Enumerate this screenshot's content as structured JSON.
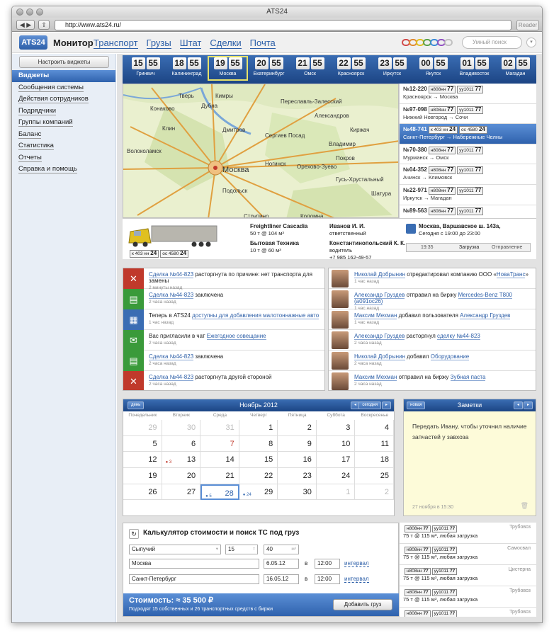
{
  "window": {
    "title": "ATS24",
    "url": "http://www.ats24.ru/",
    "reader": "Reader"
  },
  "header": {
    "logo": "ATS24",
    "title": "Монитор",
    "nav": [
      "Транспорт",
      "Грузы",
      "Штат",
      "Сделки",
      "Почта"
    ],
    "search_placeholder": "Умный поиск"
  },
  "sidebar": {
    "config_button": "Настроить виджеты",
    "items": [
      "Виджеты",
      "Сообщения системы",
      "Действия сотрудников",
      "Подрядчики",
      "Группы компаний",
      "Баланс",
      "Статистика",
      "Отчеты",
      "Справка и помощь"
    ]
  },
  "clocks": [
    {
      "h": "15",
      "m": "55",
      "city": "Гринвич"
    },
    {
      "h": "18",
      "m": "55",
      "city": "Калининград"
    },
    {
      "h": "19",
      "m": "55",
      "city": "Москва"
    },
    {
      "h": "20",
      "m": "55",
      "city": "Екатеринбург"
    },
    {
      "h": "21",
      "m": "55",
      "city": "Омск"
    },
    {
      "h": "22",
      "m": "55",
      "city": "Красноярск"
    },
    {
      "h": "23",
      "m": "55",
      "city": "Иркутск"
    },
    {
      "h": "00",
      "m": "55",
      "city": "Якутск"
    },
    {
      "h": "01",
      "m": "55",
      "city": "Владивосток"
    },
    {
      "h": "02",
      "m": "55",
      "city": "Магадан"
    }
  ],
  "map": {
    "labels": [
      "Тверь",
      "Кимры",
      "Дубна",
      "Сергиев Посад",
      "Дмитров",
      "Клин",
      "Конаково",
      "Переславль-Залесский",
      "Александров",
      "Владимир",
      "Ногинск",
      "Орехово-Зуево",
      "Москва",
      "Подольск",
      "Гусь-Хрустальный",
      "Коломна",
      "Струпино",
      "Волоколамск",
      "Покров",
      "Киржач",
      "Шатура"
    ]
  },
  "trucks": [
    {
      "id": "№12-220",
      "p1": "н808нн",
      "p1r": "77",
      "p2": "уу1011",
      "p2r": "77",
      "route": "Красноярск → Москва"
    },
    {
      "id": "№97-098",
      "p1": "н808нн",
      "p1r": "77",
      "p2": "уу1011",
      "p2r": "77",
      "route": "Нижний Новгород → Сочи"
    },
    {
      "id": "№48-741",
      "p1": "к 403 нн",
      "p1r": "24",
      "p2": "ос 4580",
      "p2r": "24",
      "route": "Санкт-Петербург → Набережные Челны"
    },
    {
      "id": "№70-380",
      "p1": "н808нн",
      "p1r": "77",
      "p2": "уу1011",
      "p2r": "77",
      "route": "Мурманск → Омск"
    },
    {
      "id": "№04-352",
      "p1": "н808нн",
      "p1r": "77",
      "p2": "уу1011",
      "p2r": "77",
      "route": "Ачинск → Климовск"
    },
    {
      "id": "№22-971",
      "p1": "н808нн",
      "p1r": "77",
      "p2": "уу1011",
      "p2r": "77",
      "route": "Иркутск → Магадан"
    },
    {
      "id": "№89-563",
      "p1": "н808нн",
      "p1r": "77",
      "p2": "уу1011",
      "p2r": "77",
      "route": ""
    }
  ],
  "detail": {
    "truck": "Freightliner Cascadia",
    "cap": "50 т @ 104 м³",
    "cargo": "Бытовая Техника",
    "cargo_cap": "10 т @ 60 м³",
    "p1": "к 403 нн",
    "p1r": "24",
    "p2": "ос 4580",
    "p2r": "24",
    "person1": "Иванов И. И.",
    "role1": "ответственный",
    "person2": "Константинопольский К. К.",
    "role2": "водитель",
    "phone": "+7 985 162-49-57",
    "address": "Москва, Варшавское ш. 143а,",
    "time": "Сегодня с 19:00 до 23:00",
    "step_time": "19:35",
    "step1": "Загрузка",
    "step2": "Отправление"
  },
  "events": [
    {
      "link": "Сделка №44-823",
      "text": " расторгнута по причине: нет транспорта для замены",
      "time": "2 минуты назад",
      "color": "#c0392b",
      "icon": "✕"
    },
    {
      "link": "Сделка №44-823",
      "text": " заключена",
      "time": "2 часа назад",
      "color": "#3a9a3a",
      "icon": "▤"
    },
    {
      "pre": "Теперь в ATS24 ",
      "link": "доступны для добавления малотоннажные авто",
      "text": "",
      "time": "1 час назад",
      "color": "#3a6db3",
      "icon": "▦"
    },
    {
      "pre": "Вас пригласили в чат ",
      "link": "Ежегодное совещание",
      "text": "",
      "time": "2 часа назад",
      "color": "#3a9a3a",
      "icon": "✉"
    },
    {
      "link": "Сделка №44-823",
      "text": " заключена",
      "time": "2 часа назад",
      "color": "#3a9a3a",
      "icon": "▤"
    },
    {
      "link": "Сделка №44-823",
      "text": " расторгнута другой стороной",
      "time": "2 часа назад",
      "color": "#c0392b",
      "icon": "✕"
    }
  ],
  "feed": [
    {
      "who": "Николай Добрынин",
      "what": " отредактировал компанию ООО «",
      "obj": "НоваТранс",
      "post": "»",
      "time": "1 час назад"
    },
    {
      "who": "Александр Груздев",
      "what": " отправил на биржу ",
      "obj": "Mercedes-Benz T800 (а091ос26)",
      "post": "",
      "time": "1 час назад"
    },
    {
      "who": "Максим Мехман",
      "what": " добавил пользователя ",
      "obj": "Александр Груздев",
      "post": "",
      "time": "1 час назад"
    },
    {
      "who": "Александр Груздев",
      "what": " расторгнул ",
      "obj": "сделку №44-823",
      "post": "",
      "time": "2 часа назад"
    },
    {
      "who": "Николай Добрынин",
      "what": " добавил ",
      "obj": "Оборудование",
      "post": "",
      "time": "2 часа назад"
    },
    {
      "who": "Максим Мехман",
      "what": " отправил на биржу ",
      "obj": "Зубная паста",
      "post": "",
      "time": "2 часа назад"
    }
  ],
  "calendar": {
    "month": "Ноябрь 2012",
    "day_btn": "день",
    "today_btn": "сегодня",
    "weekdays": [
      "Понедельник",
      "Вторник",
      "Среда",
      "Четверг",
      "Пятница",
      "Суббота",
      "Воскресенье"
    ],
    "days": [
      [
        "29",
        "o"
      ],
      [
        "30",
        "o"
      ],
      [
        "31",
        "o"
      ],
      [
        "1",
        ""
      ],
      [
        "2",
        ""
      ],
      [
        "3",
        ""
      ],
      [
        "4",
        ""
      ],
      [
        "5",
        ""
      ],
      [
        "6",
        ""
      ],
      [
        "7",
        "red"
      ],
      [
        "8",
        ""
      ],
      [
        "9",
        ""
      ],
      [
        "10",
        ""
      ],
      [
        "11",
        ""
      ],
      [
        "12",
        ""
      ],
      [
        "13",
        ""
      ],
      [
        "14",
        ""
      ],
      [
        "15",
        ""
      ],
      [
        "16",
        ""
      ],
      [
        "17",
        ""
      ],
      [
        "18",
        ""
      ],
      [
        "19",
        ""
      ],
      [
        "20",
        ""
      ],
      [
        "21",
        ""
      ],
      [
        "22",
        ""
      ],
      [
        "23",
        ""
      ],
      [
        "24",
        ""
      ],
      [
        "25",
        ""
      ],
      [
        "26",
        ""
      ],
      [
        "27",
        ""
      ],
      [
        "28",
        "today"
      ],
      [
        "29",
        ""
      ],
      [
        "30",
        ""
      ],
      [
        "1",
        "o"
      ],
      [
        "2",
        "o"
      ]
    ],
    "marks": {
      "13": "3",
      "28": "5",
      "29": "24"
    }
  },
  "notes": {
    "title": "Заметки",
    "new_btn": "новая",
    "text": "Передать Ивану, чтобы уточнил наличие запчастей у завхоза",
    "date": "27 ноября в 15:30"
  },
  "calc": {
    "title": "Калькулятор стоимости и поиск ТС под груз",
    "type": "Сыпучий",
    "weight": "15",
    "weight_unit": "т",
    "volume": "40",
    "volume_unit": "м³",
    "from": "Москва",
    "from_date": "6.05.12",
    "from_time": "12:00",
    "to": "Санкт-Петербург",
    "to_date": "16.05.12",
    "to_time": "12:00",
    "interval": "интервал",
    "in": "в",
    "cost": "Стоимость: ≈ 35 500 ₽",
    "cost_sub": "Подходят 15 собственных и 26 транспортных средств с биржи",
    "add_btn": "Добавить груз"
  },
  "results": [
    {
      "p1": "н808нн",
      "p1r": "77",
      "p2": "уу1011",
      "p2r": "77",
      "spec": "75 т @ 115 м³, любая загрузка",
      "type": "Трубовоз"
    },
    {
      "p1": "н808нн",
      "p1r": "77",
      "p2": "уу1011",
      "p2r": "77",
      "spec": "75 т @ 115 м³, любая загрузка",
      "type": "Самосвал"
    },
    {
      "p1": "н808нн",
      "p1r": "77",
      "p2": "уу1011",
      "p2r": "77",
      "spec": "75 т @ 115 м³, любая загрузка",
      "type": "Цистерна"
    },
    {
      "p1": "н808нн",
      "p1r": "77",
      "p2": "уу1011",
      "p2r": "77",
      "spec": "75 т @ 115 м³, любая загрузка",
      "type": "Трубовоз"
    },
    {
      "p1": "н808нн",
      "p1r": "77",
      "p2": "уу1011",
      "p2r": "77",
      "spec": "",
      "type": "Трубовоз"
    }
  ],
  "colors": {
    "accent": "#2f62ad",
    "header_blue": "#1c4584",
    "highlight": "#e6e26b"
  }
}
